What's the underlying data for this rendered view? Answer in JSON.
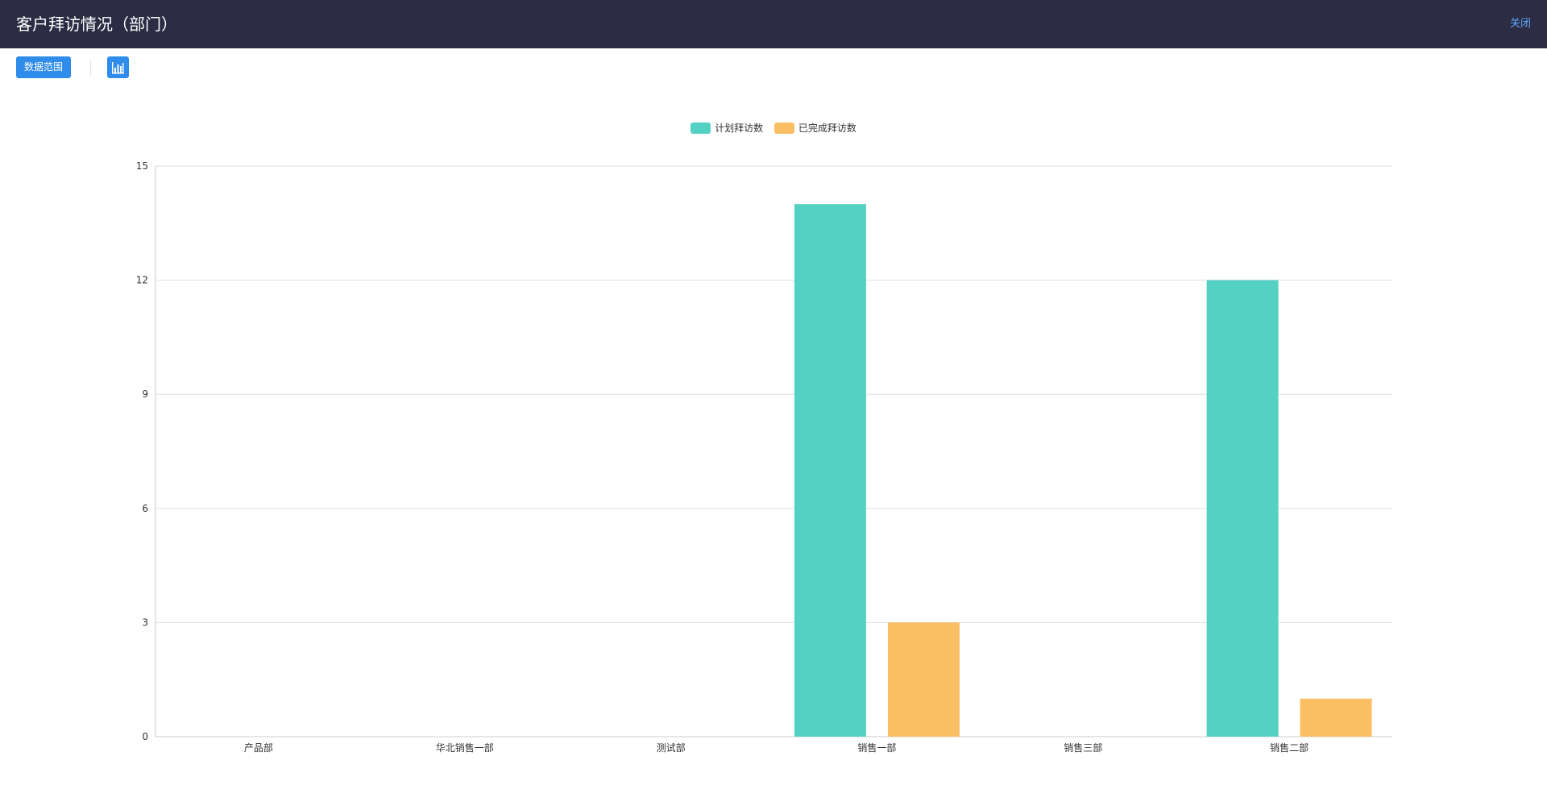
{
  "header": {
    "title": "客户拜访情况（部门）",
    "close_label": "关闭"
  },
  "toolbar": {
    "range_label": "数据范围",
    "chart_icon": "bar-chart-icon"
  },
  "colors": {
    "header_bg": "#2c2d44",
    "accent": "#2f8ceb",
    "series_planned": "#55d1c4",
    "series_done": "#f9bf62"
  },
  "chart_data": {
    "type": "bar",
    "categories": [
      "产品部",
      "华北销售一部",
      "测试部",
      "销售一部",
      "销售三部",
      "销售二部"
    ],
    "series": [
      {
        "name": "计划拜访数",
        "values": [
          0,
          0,
          0,
          14,
          0,
          12
        ],
        "color": "#55d1c4"
      },
      {
        "name": "已完成拜访数",
        "values": [
          0,
          0,
          0,
          3,
          0,
          1
        ],
        "color": "#f9bf62"
      }
    ],
    "ylim": [
      0,
      15
    ],
    "yticks": [
      "0",
      "3",
      "6",
      "9",
      "12",
      "15"
    ],
    "grid": true,
    "legend": "top-center"
  }
}
